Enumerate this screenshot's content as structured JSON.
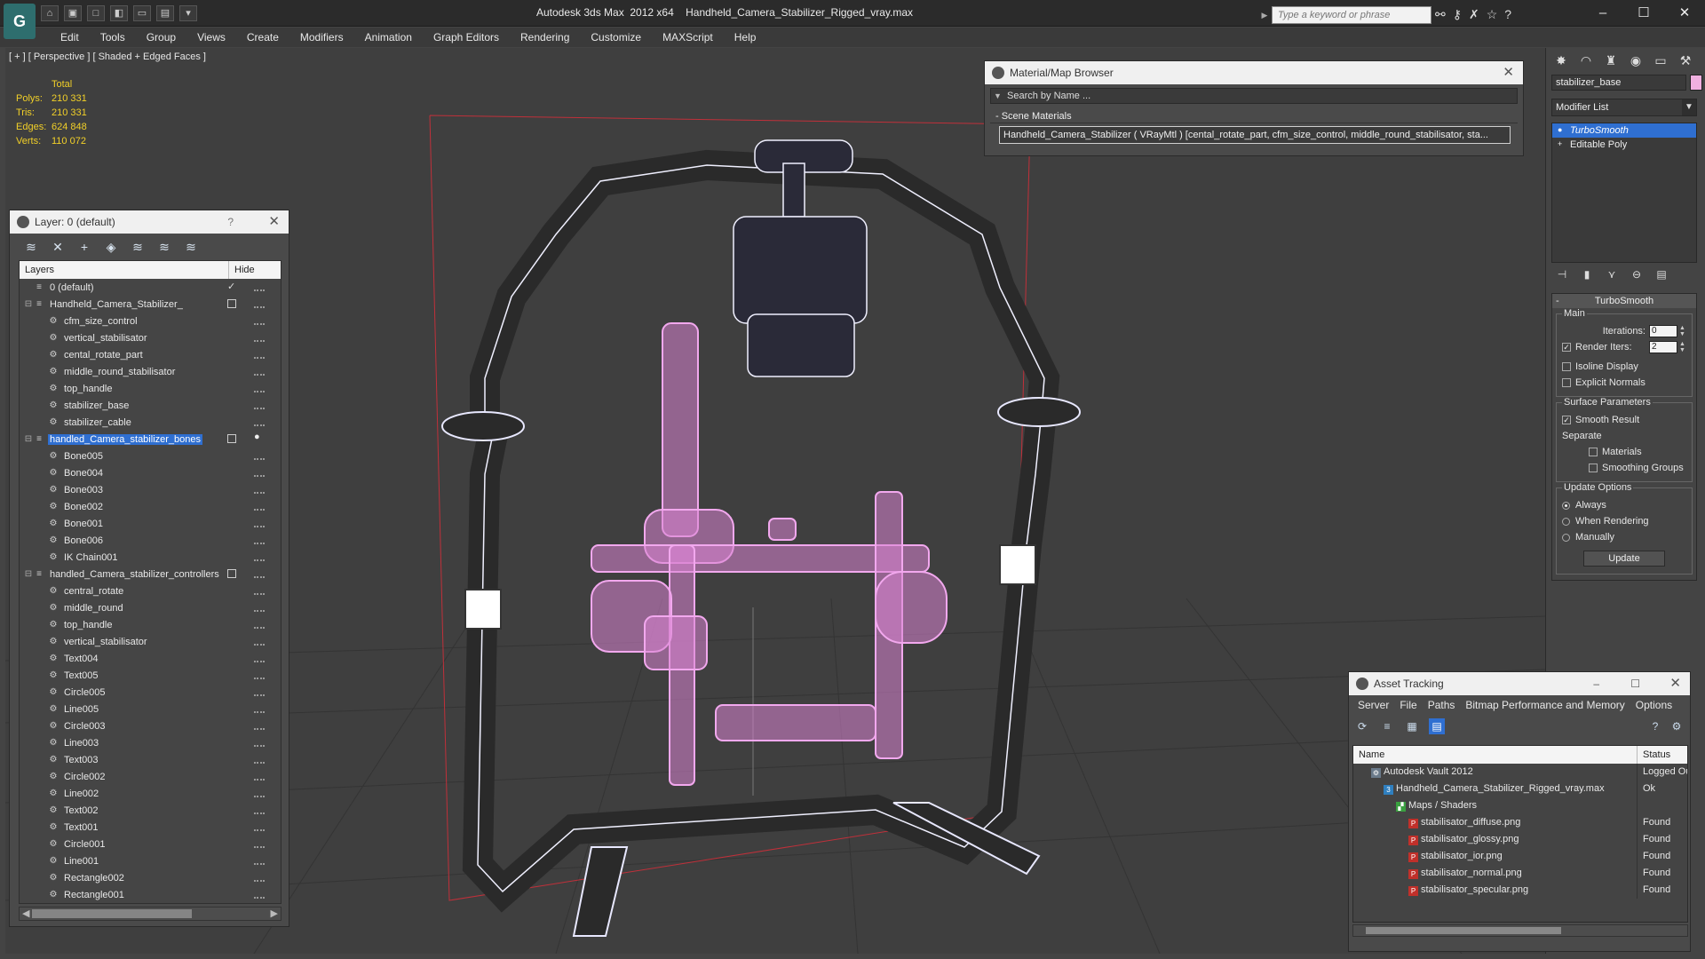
{
  "titlebar": {
    "app_title": "Autodesk 3ds Max  2012 x64",
    "file_name": "Handheld_Camera_Stabilizer_Rigged_vray.max",
    "search_placeholder": "Type a keyword or phrase",
    "logo": "G"
  },
  "menu": [
    "Edit",
    "Tools",
    "Group",
    "Views",
    "Create",
    "Modifiers",
    "Animation",
    "Graph Editors",
    "Rendering",
    "Customize",
    "MAXScript",
    "Help"
  ],
  "viewport": {
    "label": "[ + ] [ Perspective ] [ Shaded + Edged Faces ]",
    "stats_header": "Total",
    "stats": [
      {
        "k": "Polys:",
        "v": "210 331"
      },
      {
        "k": "Tris:",
        "v": "210 331"
      },
      {
        "k": "Edges:",
        "v": "624 848"
      },
      {
        "k": "Verts:",
        "v": "110 072"
      }
    ]
  },
  "layer_panel": {
    "title": "Layer: 0 (default)",
    "help": "?",
    "col_layers": "Layers",
    "col_hide": "Hide",
    "rows": [
      {
        "name": "0 (default)",
        "level": 0,
        "type": "layer",
        "check": true
      },
      {
        "name": "Handheld_Camera_Stabilizer_",
        "level": 0,
        "type": "layer",
        "expand": true,
        "box": true
      },
      {
        "name": "cfm_size_control",
        "level": 1,
        "type": "obj"
      },
      {
        "name": "vertical_stabilisator",
        "level": 1,
        "type": "obj"
      },
      {
        "name": "cental_rotate_part",
        "level": 1,
        "type": "obj"
      },
      {
        "name": "middle_round_stabilisator",
        "level": 1,
        "type": "obj"
      },
      {
        "name": "top_handle",
        "level": 1,
        "type": "obj"
      },
      {
        "name": "stabilizer_base",
        "level": 1,
        "type": "obj"
      },
      {
        "name": "stabilizer_cable",
        "level": 1,
        "type": "obj"
      },
      {
        "name": "handled_Camera_stabilizer_bones",
        "level": 0,
        "type": "layer",
        "expand": true,
        "box": true,
        "selected": true,
        "bulb": true
      },
      {
        "name": "Bone005",
        "level": 1,
        "type": "obj"
      },
      {
        "name": "Bone004",
        "level": 1,
        "type": "obj"
      },
      {
        "name": "Bone003",
        "level": 1,
        "type": "obj"
      },
      {
        "name": "Bone002",
        "level": 1,
        "type": "obj"
      },
      {
        "name": "Bone001",
        "level": 1,
        "type": "obj"
      },
      {
        "name": "Bone006",
        "level": 1,
        "type": "obj"
      },
      {
        "name": "IK Chain001",
        "level": 1,
        "type": "obj"
      },
      {
        "name": "handled_Camera_stabilizer_controllers",
        "level": 0,
        "type": "layer",
        "expand": true,
        "box": true
      },
      {
        "name": "central_rotate",
        "level": 1,
        "type": "obj"
      },
      {
        "name": "middle_round",
        "level": 1,
        "type": "obj"
      },
      {
        "name": "top_handle",
        "level": 1,
        "type": "obj"
      },
      {
        "name": "vertical_stabilisator",
        "level": 1,
        "type": "obj"
      },
      {
        "name": "Text004",
        "level": 1,
        "type": "obj"
      },
      {
        "name": "Text005",
        "level": 1,
        "type": "obj"
      },
      {
        "name": "Circle005",
        "level": 1,
        "type": "obj"
      },
      {
        "name": "Line005",
        "level": 1,
        "type": "obj"
      },
      {
        "name": "Circle003",
        "level": 1,
        "type": "obj"
      },
      {
        "name": "Line003",
        "level": 1,
        "type": "obj"
      },
      {
        "name": "Text003",
        "level": 1,
        "type": "obj"
      },
      {
        "name": "Circle002",
        "level": 1,
        "type": "obj"
      },
      {
        "name": "Line002",
        "level": 1,
        "type": "obj"
      },
      {
        "name": "Text002",
        "level": 1,
        "type": "obj"
      },
      {
        "name": "Text001",
        "level": 1,
        "type": "obj"
      },
      {
        "name": "Circle001",
        "level": 1,
        "type": "obj"
      },
      {
        "name": "Line001",
        "level": 1,
        "type": "obj"
      },
      {
        "name": "Rectangle002",
        "level": 1,
        "type": "obj"
      },
      {
        "name": "Rectangle001",
        "level": 1,
        "type": "obj"
      }
    ]
  },
  "material_browser": {
    "title": "Material/Map Browser",
    "search_placeholder": "Search by Name ...",
    "group": "- Scene Materials",
    "item": "Handheld_Camera_Stabilizer ( VRayMtl ) [cental_rotate_part, cfm_size_control, middle_round_stabilisator, sta..."
  },
  "command_panel": {
    "object_name": "stabilizer_base",
    "object_color": "#f0b0e0",
    "modifier_list": "Modifier List",
    "stack": [
      {
        "name": "TurboSmooth",
        "active": true
      },
      {
        "name": "Editable Poly",
        "active": false
      }
    ],
    "rollout_title": "TurboSmooth",
    "main_label": "Main",
    "iterations_label": "Iterations:",
    "iterations_value": "0",
    "render_iters_label": "Render Iters:",
    "render_iters_value": "2",
    "render_iters_checked": true,
    "isoline_label": "Isoline Display",
    "explicit_label": "Explicit Normals",
    "surface_label": "Surface Parameters",
    "smooth_label": "Smooth Result",
    "separate_label": "Separate",
    "materials_label": "Materials",
    "smoothing_groups_label": "Smoothing Groups",
    "update_options_label": "Update Options",
    "opt_always": "Always",
    "opt_rendering": "When Rendering",
    "opt_manually": "Manually",
    "update_button": "Update"
  },
  "asset_tracking": {
    "title": "Asset Tracking",
    "menu": [
      "Server",
      "File",
      "Paths",
      "Bitmap Performance and Memory",
      "Options"
    ],
    "col_name": "Name",
    "col_status": "Status",
    "rows": [
      {
        "name": "Autodesk Vault 2012",
        "status": "Logged Ou",
        "level": 1,
        "icon": "vault"
      },
      {
        "name": "Handheld_Camera_Stabilizer_Rigged_vray.max",
        "status": "Ok",
        "level": 2,
        "icon": "max"
      },
      {
        "name": "Maps / Shaders",
        "status": "",
        "level": 3,
        "icon": "maps"
      },
      {
        "name": "stabilisator_diffuse.png",
        "status": "Found",
        "level": 4,
        "icon": "png"
      },
      {
        "name": "stabilisator_glossy.png",
        "status": "Found",
        "level": 4,
        "icon": "png"
      },
      {
        "name": "stabilisator_ior.png",
        "status": "Found",
        "level": 4,
        "icon": "png"
      },
      {
        "name": "stabilisator_normal.png",
        "status": "Found",
        "level": 4,
        "icon": "png"
      },
      {
        "name": "stabilisator_specular.png",
        "status": "Found",
        "level": 4,
        "icon": "png"
      }
    ]
  }
}
